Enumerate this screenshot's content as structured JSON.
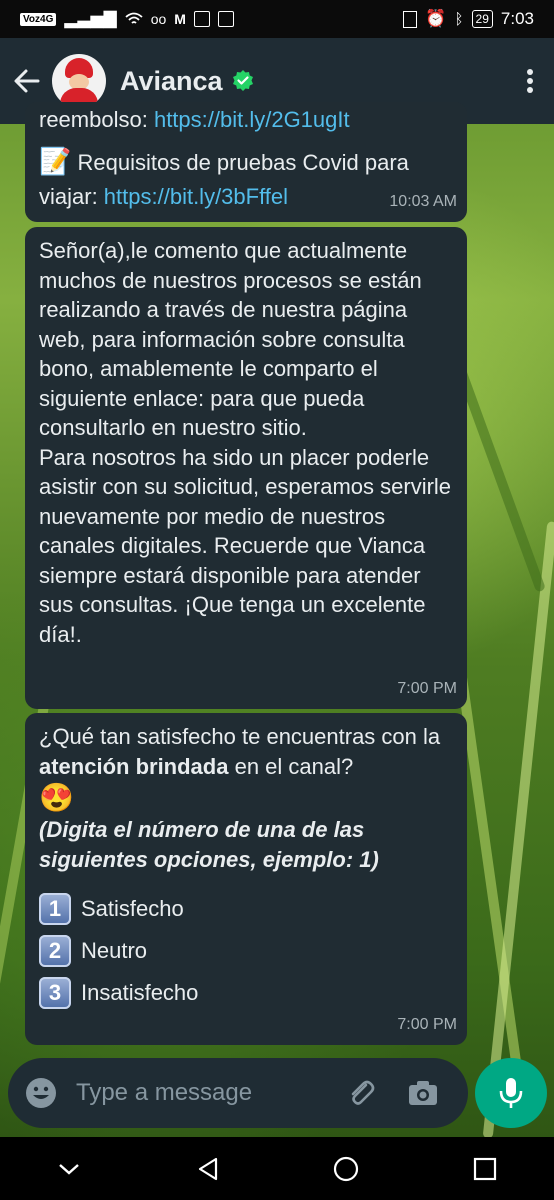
{
  "status_bar": {
    "carrier": "Voz4G",
    "battery": "29",
    "time": "7:03"
  },
  "header": {
    "title": "Avianca"
  },
  "messages": [
    {
      "lines": [
        {
          "text": "reembolso: ",
          "link": "https://bit.ly/2G1ugIt"
        },
        {
          "emoji": "📝",
          "text": "Requisitos de pruebas Covid para"
        },
        {
          "text": "viajar: ",
          "link": "https://bit.ly/3bFffel"
        }
      ],
      "time": "10:03 AM"
    },
    {
      "text": "Señor(a),le comento que actualmente muchos de nuestros procesos se están realizando a través de nuestra página web, para información sobre consulta bono, amablemente le comparto el siguiente enlace:  para que pueda consultarlo en nuestro sitio.\nPara nosotros ha sido un placer poderle asistir con su solicitud, esperamos servirle nuevamente por medio de nuestros canales digitales. Recuerde que Vianca siempre estará disponible para atender sus consultas. ¡Que tenga un excelente día!.",
      "time": "7:00 PM"
    },
    {
      "question_start": "¿Qué tan satisfecho te encuentras con la ",
      "question_bold": "atención brindada",
      "question_end": " en el canal?",
      "emoji": "😍",
      "instruction": "(Digita el número de una de las siguientes opciones, ejemplo: 1)",
      "options": [
        {
          "num": "1",
          "label": "Satisfecho"
        },
        {
          "num": "2",
          "label": "Neutro"
        },
        {
          "num": "3",
          "label": "Insatisfecho"
        }
      ],
      "time": "7:00 PM"
    }
  ],
  "input": {
    "placeholder": "Type a message"
  },
  "colors": {
    "header_bg": "#1f2c34",
    "bubble_bg": "#202c33",
    "link": "#53bdeb",
    "accent": "#00a884"
  }
}
